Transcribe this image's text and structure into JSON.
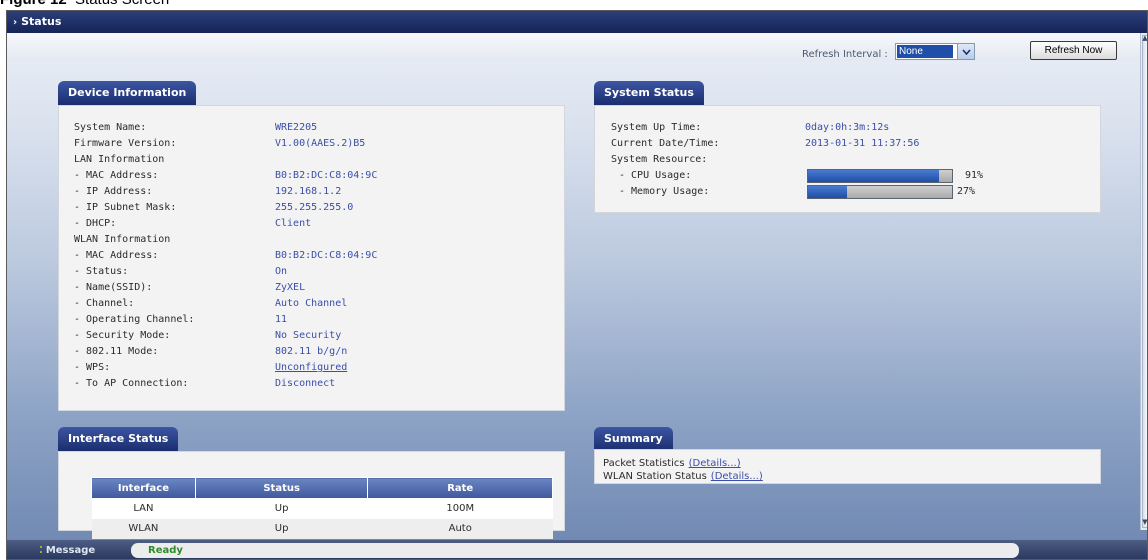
{
  "figure_caption": {
    "label": "Figure 12",
    "title": "Status Screen"
  },
  "window": {
    "title": "Status"
  },
  "toolbar": {
    "refresh_interval_label": "Refresh Interval :",
    "refresh_interval_value": "None",
    "refresh_now_label": "Refresh Now"
  },
  "device_information": {
    "title": "Device Information",
    "rows": [
      {
        "label": "System Name:",
        "value": "WRE2205"
      },
      {
        "label": "Firmware Version:",
        "value": "V1.00(AAES.2)B5"
      },
      {
        "label": "LAN Information",
        "value": ""
      },
      {
        "label": "- MAC Address:",
        "value": "B0:B2:DC:C8:04:9C"
      },
      {
        "label": "- IP Address:",
        "value": "192.168.1.2"
      },
      {
        "label": "- IP Subnet Mask:",
        "value": "255.255.255.0"
      },
      {
        "label": "- DHCP:",
        "value": "Client"
      },
      {
        "label": "WLAN Information",
        "value": ""
      },
      {
        "label": "- MAC Address:",
        "value": "B0:B2:DC:C8:04:9C"
      },
      {
        "label": "- Status:",
        "value": "On"
      },
      {
        "label": "- Name(SSID):",
        "value": "ZyXEL"
      },
      {
        "label": "- Channel:",
        "value": "Auto Channel"
      },
      {
        "label": "- Operating Channel:",
        "value": "11"
      },
      {
        "label": "- Security Mode:",
        "value": "No Security"
      },
      {
        "label": "- 802.11 Mode:",
        "value": "802.11 b/g/n"
      },
      {
        "label": "- WPS:",
        "value": "Unconfigured"
      },
      {
        "label": "- To AP Connection:",
        "value": "Disconnect"
      }
    ]
  },
  "system_status": {
    "title": "System Status",
    "up_time_label": "System Up Time:",
    "up_time_value": "0day:0h:3m:12s",
    "datetime_label": "Current Date/Time:",
    "datetime_value": "2013-01-31 11:37:56",
    "resource_label": "System Resource:",
    "cpu_label": "- CPU Usage:",
    "cpu_percent": 91,
    "cpu_text": "91%",
    "memory_label": "- Memory Usage:",
    "memory_percent": 27,
    "memory_text": "27%"
  },
  "interface_status": {
    "title": "Interface Status",
    "columns": [
      "Interface",
      "Status",
      "Rate"
    ],
    "rows": [
      [
        "LAN",
        "Up",
        "100M"
      ],
      [
        "WLAN",
        "Up",
        "Auto"
      ]
    ]
  },
  "summary": {
    "title": "Summary",
    "packet_label": "Packet Statistics",
    "packet_link": "(Details...)",
    "wlan_label": "WLAN Station Status",
    "wlan_link": "(Details...)"
  },
  "status_bar": {
    "label": "Message",
    "text": "Ready"
  },
  "colors": {
    "accent": "#1b2d6e",
    "link": "#3a4fa8",
    "ready": "#2e8a2a",
    "bar_fill": "#1e4fa6"
  }
}
